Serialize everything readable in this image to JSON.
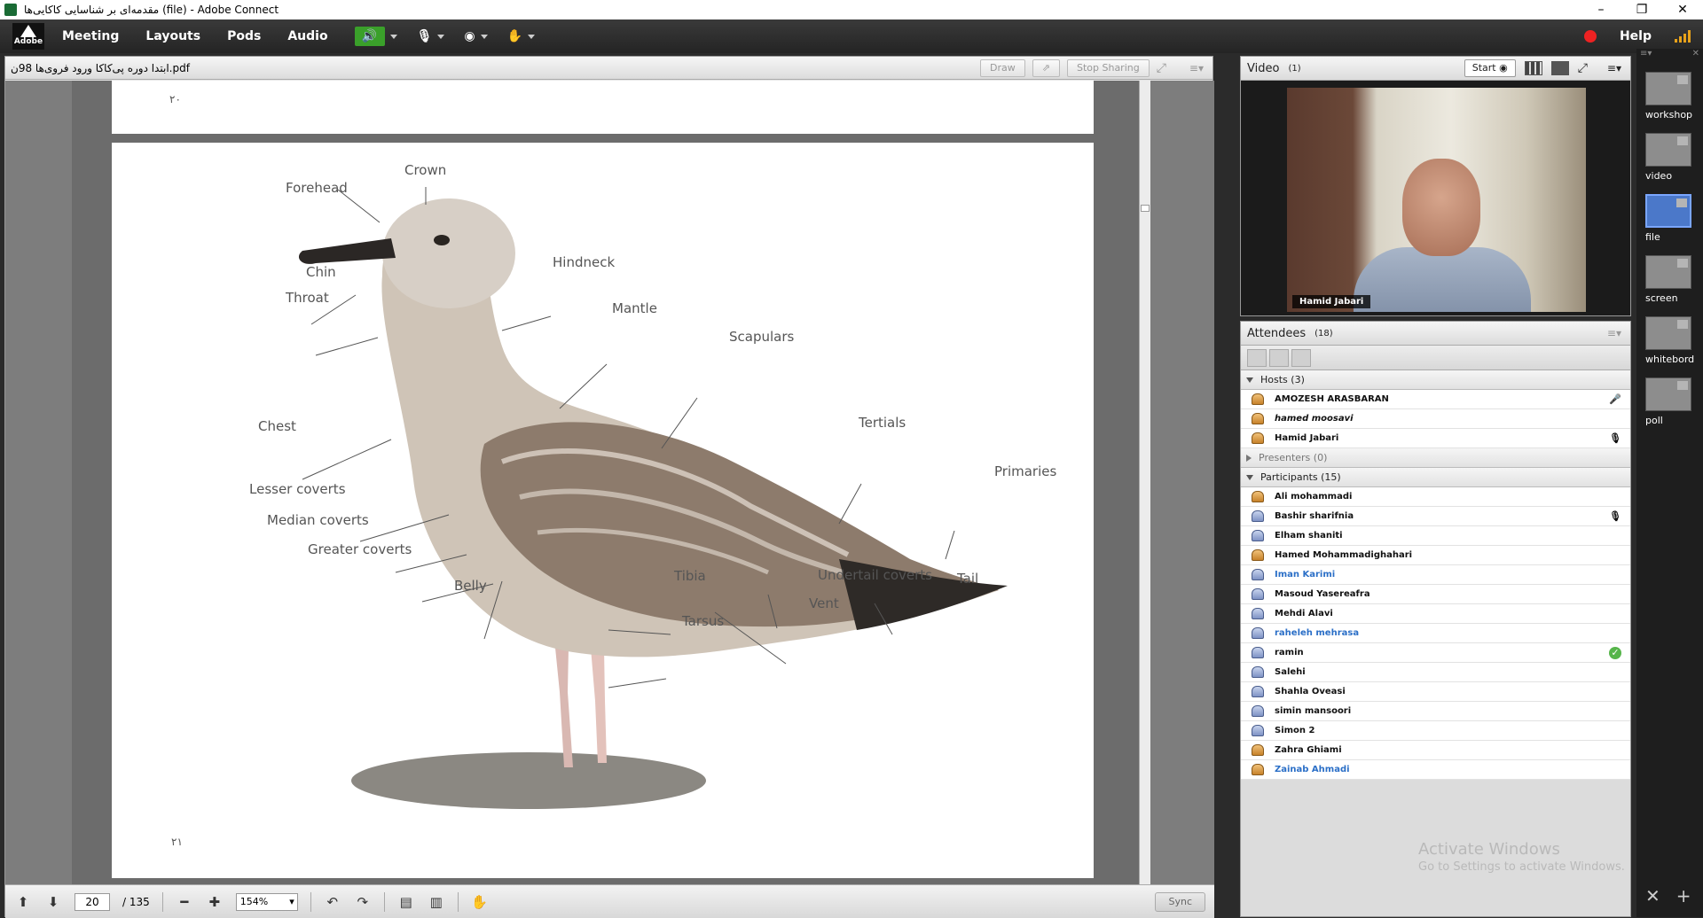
{
  "window": {
    "title": "مقدمه‌ای بر شناسایی کاکایی‌ها (file) - Adobe Connect",
    "controls": [
      "–",
      "❐",
      "✕"
    ]
  },
  "menubar": {
    "logo_text": "Adobe",
    "items": [
      "Meeting",
      "Layouts",
      "Pods",
      "Audio"
    ],
    "help": "Help",
    "speaker_color": "#3aa02a",
    "record_color": "#e22222"
  },
  "share_pod": {
    "filename": "ابتدا دوره پی‌کاکا ورود فروی‌ها 98ن.pdf",
    "buttons": {
      "draw": "Draw",
      "stop_sharing": "Stop Sharing"
    },
    "page_prev_number": "۲۰",
    "page_number_label": "۲۱",
    "footer": {
      "current_page": "20",
      "total_pages": "/ 135",
      "zoom": "154%",
      "sync": "Sync"
    },
    "bird_labels": {
      "crown": "Crown",
      "forehead": "Forehead",
      "hindneck": "Hindneck",
      "chin": "Chin",
      "throat": "Throat",
      "mantle": "Mantle",
      "scapulars": "Scapulars",
      "chest": "Chest",
      "tertials": "Tertials",
      "primaries": "Primaries",
      "lesser_coverts": "Lesser coverts",
      "median_coverts": "Median coverts",
      "greater_coverts": "Greater coverts",
      "belly": "Belly",
      "tibia": "Tibia",
      "undertail_coverts": "Undertail coverts",
      "tail": "Tail",
      "vent": "Vent",
      "tarsus": "Tarsus"
    }
  },
  "video_pod": {
    "title": "Video",
    "count": "(1)",
    "start": "Start",
    "name_tag": "Hamid Jabari"
  },
  "attendees_pod": {
    "title": "Attendees",
    "count": "(18)",
    "hosts_label": "Hosts (3)",
    "hosts": [
      {
        "name": "AMOZESH ARASBARAN",
        "status": "🎤"
      },
      {
        "name": "hamed moosavi",
        "status": ""
      },
      {
        "name": "Hamid Jabari",
        "status": "🎙"
      }
    ],
    "presenters_label": "Presenters (0)",
    "participants_label": "Participants (15)",
    "participants": [
      {
        "name": "Ali mohammadi",
        "status": ""
      },
      {
        "name": "Bashir sharifnia",
        "status": "🎙"
      },
      {
        "name": "Elham shaniti",
        "status": ""
      },
      {
        "name": "Hamed Mohammadighahari",
        "status": ""
      },
      {
        "name": "Iman Karimi",
        "status": ""
      },
      {
        "name": "Masoud Yasereafra",
        "status": ""
      },
      {
        "name": "Mehdi Alavi",
        "status": ""
      },
      {
        "name": "raheleh mehrasa",
        "status": ""
      },
      {
        "name": "ramin",
        "status": "✓"
      },
      {
        "name": "Salehi",
        "status": ""
      },
      {
        "name": "Shahla Oveasi",
        "status": ""
      },
      {
        "name": "simin mansoori",
        "status": ""
      },
      {
        "name": "Simon 2",
        "status": ""
      },
      {
        "name": "Zahra Ghiami",
        "status": ""
      },
      {
        "name": "Zainab Ahmadi",
        "status": ""
      }
    ],
    "watermark_line1": "Activate Windows",
    "watermark_line2": "Go to Settings to activate Windows."
  },
  "layouts": {
    "items": [
      "workshop",
      "video",
      "file",
      "screen",
      "whitebord",
      "poll"
    ],
    "active": "file"
  }
}
